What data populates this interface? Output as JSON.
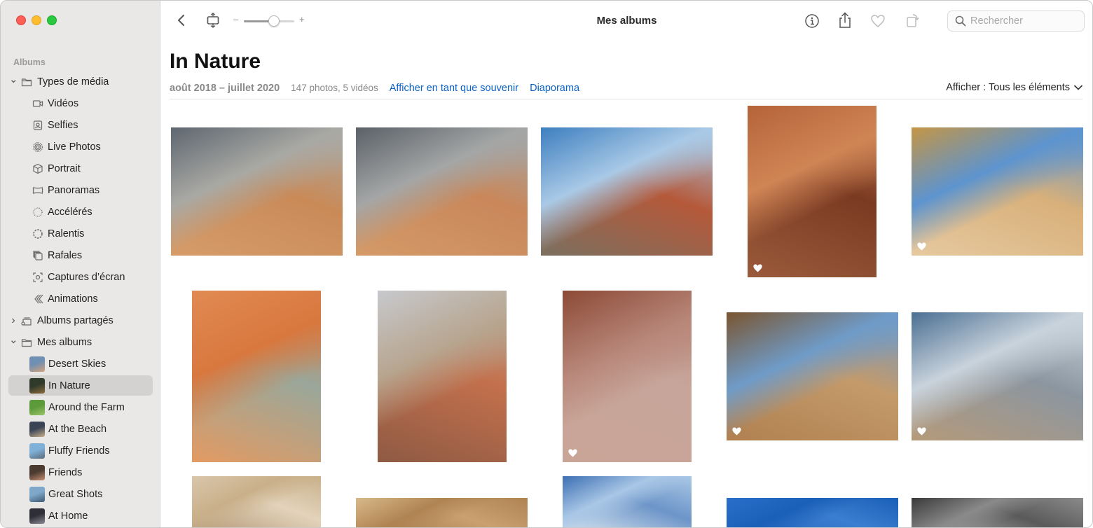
{
  "window": {
    "title": "Mes albums"
  },
  "toolbar": {
    "back_icon": "chevron-left-icon",
    "view_icon": "fit-frame-icon",
    "zoom_minus": "–",
    "zoom_plus": "+",
    "zoom_level": 0.6,
    "info_icon": "info-icon",
    "share_icon": "share-icon",
    "favorite_icon": "heart-icon",
    "rotate_icon": "rotate-icon"
  },
  "search": {
    "placeholder": "Rechercher",
    "value": ""
  },
  "sidebar": {
    "heading": "Albums",
    "groups": [
      {
        "label": "Types de média",
        "icon": "folder-icon",
        "expanded": true,
        "items": [
          {
            "label": "Vidéos",
            "icon": "video-icon"
          },
          {
            "label": "Selfies",
            "icon": "selfie-icon"
          },
          {
            "label": "Live Photos",
            "icon": "live-photo-icon"
          },
          {
            "label": "Portrait",
            "icon": "portrait-cube-icon"
          },
          {
            "label": "Panoramas",
            "icon": "panorama-icon"
          },
          {
            "label": "Accélérés",
            "icon": "timelapse-icon"
          },
          {
            "label": "Ralentis",
            "icon": "slomo-icon"
          },
          {
            "label": "Rafales",
            "icon": "burst-icon"
          },
          {
            "label": "Captures d’écran",
            "icon": "screenshot-icon"
          },
          {
            "label": "Animations",
            "icon": "animation-icon"
          }
        ]
      },
      {
        "label": "Albums partagés",
        "icon": "shared-album-icon",
        "expanded": false,
        "items": []
      },
      {
        "label": "Mes albums",
        "icon": "folder-icon",
        "expanded": true,
        "items": [
          {
            "label": "Desert Skies",
            "thumb": [
              "#6f8fb3",
              "#d4a27a"
            ]
          },
          {
            "label": "In Nature",
            "thumb": [
              "#2f3a2a",
              "#8b6b3d"
            ],
            "selected": true
          },
          {
            "label": "Around the Farm",
            "thumb": [
              "#5c9a3a",
              "#9cc46a"
            ]
          },
          {
            "label": "At the Beach",
            "thumb": [
              "#3a4455",
              "#c9b08a"
            ]
          },
          {
            "label": "Fluffy Friends",
            "thumb": [
              "#7fb0d8",
              "#5a6b7a"
            ]
          },
          {
            "label": "Friends",
            "thumb": [
              "#4a3a30",
              "#c48e72"
            ]
          },
          {
            "label": "Great Shots",
            "thumb": [
              "#7ea7c9",
              "#3f5a73"
            ]
          },
          {
            "label": "At Home",
            "thumb": [
              "#2f2f38",
              "#8a8a95"
            ]
          }
        ]
      }
    ]
  },
  "album": {
    "title": "In Nature",
    "date_range": "août 2018 – juillet 2020",
    "counts": "147 photos, 5 vidéos",
    "memory_link": "Afficher en tant que souvenir",
    "slideshow_link": "Diaporama",
    "filter": "Afficher : Tous les éléments"
  },
  "photos": [
    {
      "favorite": false,
      "colors": [
        "#5e6670",
        "#a9a9a4",
        "#c98a58",
        "#d59c6a"
      ]
    },
    {
      "favorite": false,
      "colors": [
        "#5b6168",
        "#a4a6a6",
        "#c9875a",
        "#d49a68"
      ]
    },
    {
      "favorite": false,
      "colors": [
        "#3d7fc0",
        "#a9c9e6",
        "#b5593a",
        "#7b7060"
      ]
    },
    {
      "favorite": true,
      "colors": [
        "#b5633a",
        "#d08555",
        "#7a3a22",
        "#9a5a3a"
      ]
    },
    {
      "favorite": true,
      "colors": [
        "#c49545",
        "#5d94cf",
        "#d8b07a",
        "#e6c9a0"
      ]
    },
    {
      "favorite": false,
      "colors": [
        "#e08a52",
        "#d8783f",
        "#9aa79a",
        "#e39a62"
      ]
    },
    {
      "favorite": false,
      "colors": [
        "#c7c9cd",
        "#b7a58f",
        "#c3704c",
        "#8e5a44"
      ]
    },
    {
      "favorite": true,
      "colors": [
        "#8c4a35",
        "#b8877a",
        "#c7a59a",
        "#c9a597"
      ]
    },
    {
      "favorite": true,
      "colors": [
        "#7a5530",
        "#6f9bc8",
        "#c49a6a",
        "#b08050"
      ]
    },
    {
      "favorite": true,
      "colors": [
        "#4a6f93",
        "#c9d3dc",
        "#8c96a0",
        "#b59a7a"
      ]
    },
    {
      "favorite": false,
      "colors": [
        "#d9c6aa",
        "#c9b08a",
        "#e3d3bb",
        "#b59a78"
      ]
    },
    {
      "favorite": false,
      "colors": [
        "#d8b98a",
        "#b08352",
        "#c9a070",
        "#a77a4a"
      ]
    },
    {
      "favorite": false,
      "colors": [
        "#3c6fb3",
        "#a9c7e6",
        "#6d95c8",
        "#d6e3ef"
      ]
    },
    {
      "favorite": false,
      "colors": [
        "#2a6fc9",
        "#1a5fb8",
        "#3a7ed0",
        "#2565bf"
      ]
    },
    {
      "favorite": false,
      "colors": [
        "#3a3a3a",
        "#8a8a8a",
        "#5a5a5a",
        "#b0b0b0"
      ]
    }
  ]
}
